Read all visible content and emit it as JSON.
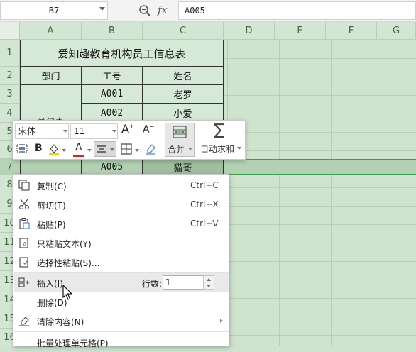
{
  "formula_bar": {
    "cell_ref": "B7",
    "fx": "fx",
    "value": "A005"
  },
  "columns": [
    "A",
    "B",
    "C",
    "D",
    "E",
    "F",
    "G"
  ],
  "rows": [
    "1",
    "2",
    "3",
    "4",
    "5",
    "6",
    "7",
    "8",
    "9",
    "10",
    "11",
    "12",
    "13",
    "14",
    "15",
    "16"
  ],
  "table": {
    "title": "爱知趣教育机构员工信息表",
    "headers": [
      "部门",
      "工号",
      "姓名"
    ],
    "dept": "总经办",
    "records": [
      {
        "id": "A001",
        "name": "老罗"
      },
      {
        "id": "A002",
        "name": "小爱"
      },
      {
        "id": "A005",
        "name": "猫哥"
      }
    ]
  },
  "mini_toolbar": {
    "font_name": "宋体",
    "font_size": "11",
    "grow_font": "A",
    "shrink_font": "A",
    "bold": "B",
    "font_color_letter": "A",
    "merge_label": "合并",
    "autosum_label": "自动求和",
    "font_color": "#e02020",
    "fill_color": "#f2d200"
  },
  "context_menu": {
    "items": [
      {
        "label": "复制(C)",
        "shortcut": "Ctrl+C",
        "icon": "copy-icon"
      },
      {
        "label": "剪切(T)",
        "shortcut": "Ctrl+X",
        "icon": "cut-icon"
      },
      {
        "label": "粘贴(P)",
        "shortcut": "Ctrl+V",
        "icon": "paste-icon"
      },
      {
        "label": "只粘贴文本(Y)",
        "icon": "paste-text-icon"
      },
      {
        "label": "选择性粘贴(S)...",
        "icon": "paste-special-icon"
      },
      {
        "label": "插入(I)",
        "icon": "insert-icon"
      },
      {
        "label": "删除(D)"
      },
      {
        "label": "清除内容(N)",
        "icon": "eraser-icon"
      },
      {
        "label": "批量处理单元格(P)"
      }
    ],
    "insert_rows_label": "行数:",
    "insert_rows_value": "1"
  },
  "colors": {
    "sheet_bg": "#cfe3cf",
    "selection_border": "#3aa14c"
  }
}
